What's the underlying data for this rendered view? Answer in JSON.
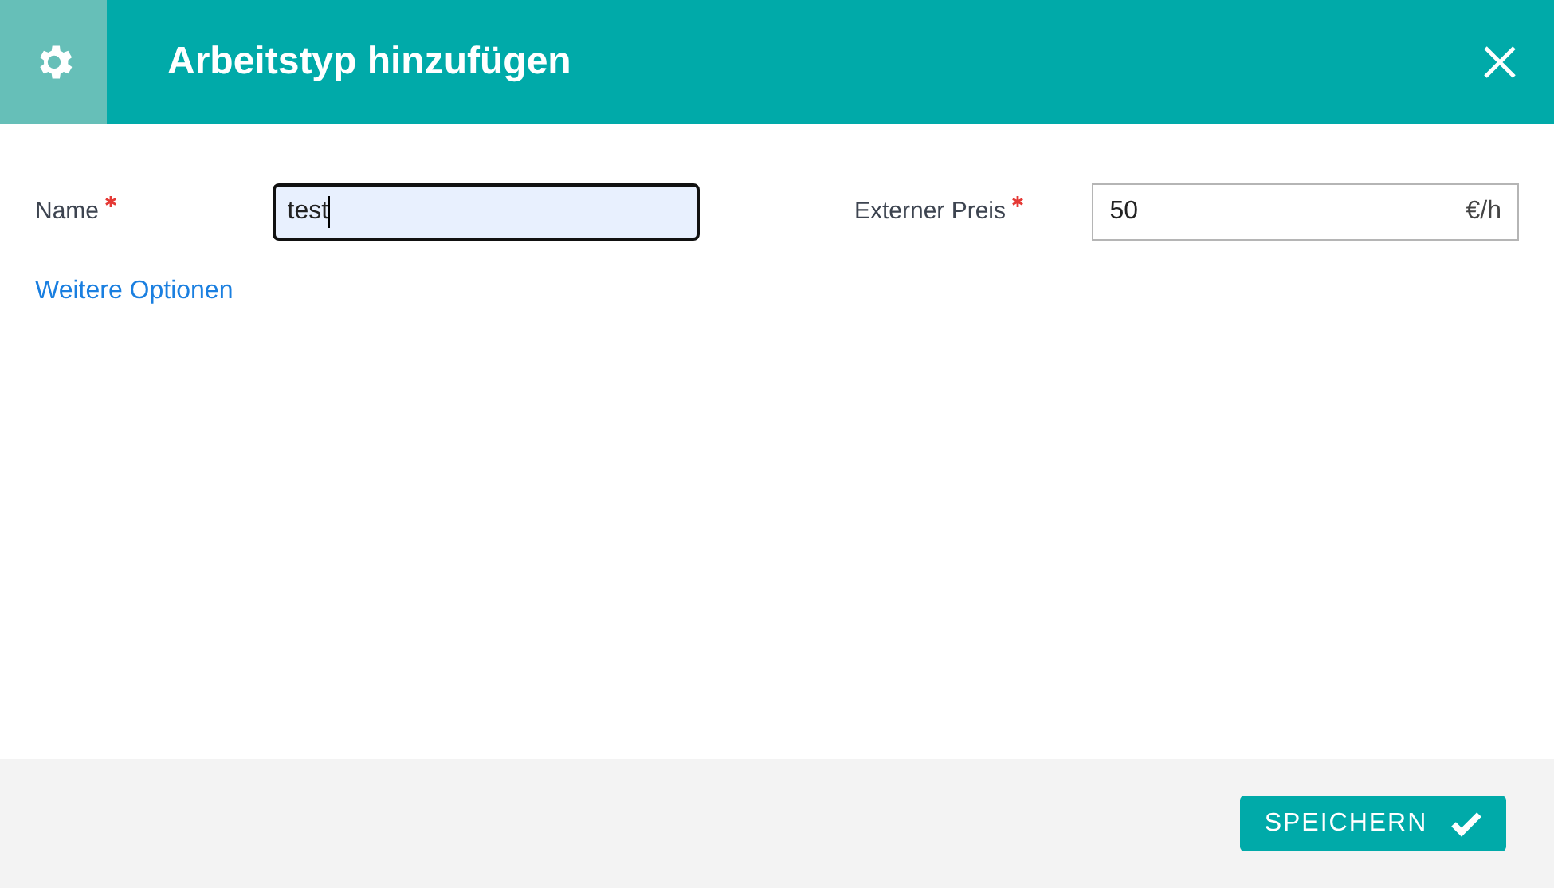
{
  "dialog": {
    "title": "Arbeitstyp hinzufügen"
  },
  "fields": [
    {
      "label": "Name",
      "required": true,
      "value": "test",
      "focused": true
    },
    {
      "label": "Externer Preis",
      "required": true,
      "value": "50",
      "unit": "€/h",
      "focused": false
    }
  ],
  "link": "Weitere Optionen",
  "footer": {
    "button": "SPEICHERN"
  }
}
